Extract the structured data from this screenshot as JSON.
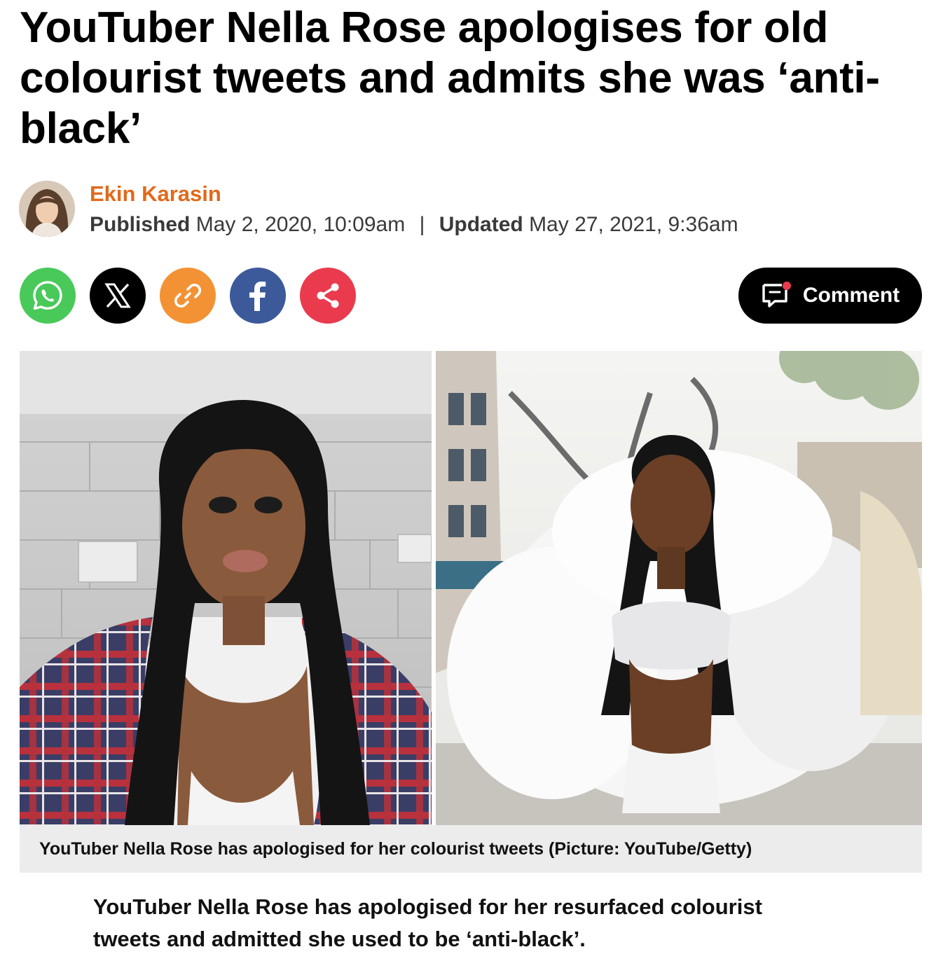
{
  "article": {
    "headline": "YouTuber Nella Rose apologises for old colourist tweets and admits she was ‘anti-black’",
    "author": {
      "name": "Ekin Karasin",
      "avatar_icon": "author-photo"
    },
    "published_label": "Published",
    "published_date": "May 2, 2020, 10:09am",
    "separator": "|",
    "updated_label": "Updated",
    "updated_date": "May 27, 2021, 9:36am",
    "image_caption": "YouTuber Nella Rose has apologised for her colourist tweets (Picture: YouTube/Getty)",
    "lead_paragraph": "YouTuber Nella Rose has apologised for her resurfaced colourist tweets and admitted she used to be ‘anti-black’."
  },
  "share": {
    "buttons": [
      {
        "name": "whatsapp",
        "icon": "whatsapp-icon",
        "color": "#49c95a"
      },
      {
        "name": "x",
        "icon": "x-icon",
        "color": "#000000"
      },
      {
        "name": "copy-link",
        "icon": "link-icon",
        "color": "#f39235"
      },
      {
        "name": "facebook",
        "icon": "facebook-icon",
        "color": "#3c5a9a"
      },
      {
        "name": "share",
        "icon": "share-icon",
        "color": "#ea3b4e"
      }
    ]
  },
  "comment": {
    "label": "Comment",
    "icon": "comment-icon",
    "notification_dot_color": "#ea3b4e"
  },
  "colors": {
    "author_name": "#e06a1b",
    "caption_background": "#ececec",
    "text": "#000000"
  }
}
